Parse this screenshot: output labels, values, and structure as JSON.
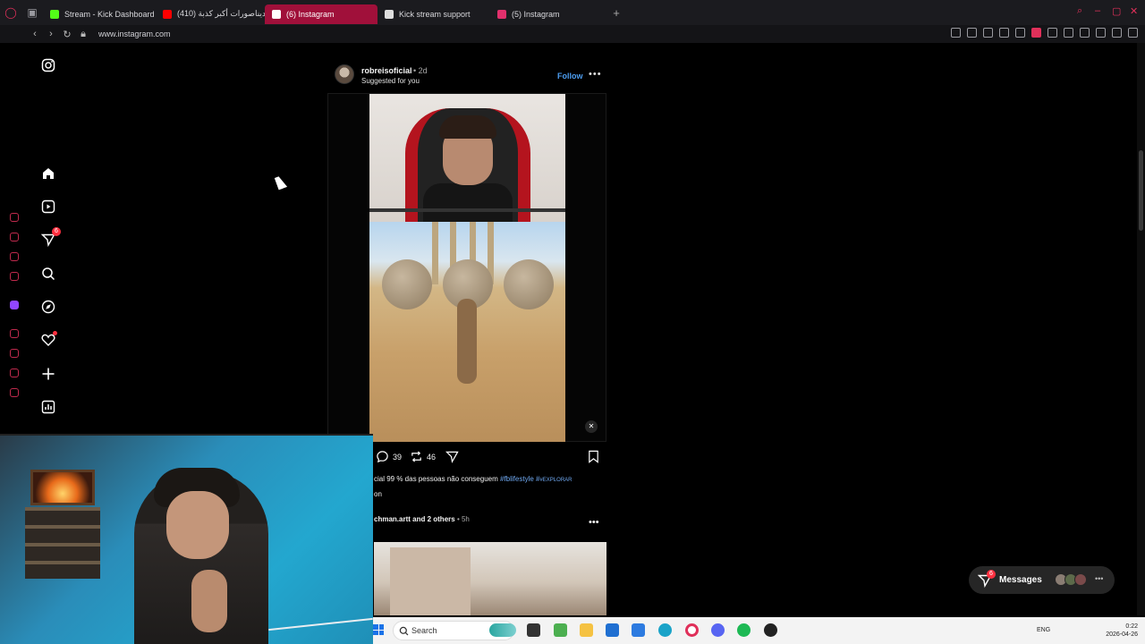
{
  "browser": {
    "tabs": [
      {
        "label": "Stream - Kick Dashboard",
        "color": "#53fc18",
        "active": false
      },
      {
        "label": "الديناصورات أكبر كذبة (410)",
        "color": "#ff0000",
        "active": false
      },
      {
        "label": "(6) Instagram",
        "color": "#e1306c",
        "active": true
      },
      {
        "label": "Kick stream support",
        "color": "#ffffff",
        "active": false
      },
      {
        "label": "(5) Instagram",
        "color": "#e1306c",
        "active": false
      }
    ],
    "url": "www.instagram.com",
    "accent": "#a0103a"
  },
  "instagram": {
    "nav": {
      "notifications_badge": "6",
      "items": [
        "instagram-logo",
        "home",
        "reels",
        "messages",
        "search",
        "explore",
        "notifications",
        "create",
        "dashboard"
      ]
    },
    "post": {
      "username": "robreisoficial",
      "time": "• 2d",
      "subtitle": "Suggested for you",
      "follow_label": "Follow",
      "more_label": "•••",
      "comments": "39",
      "reposts": "46",
      "caption_text": "cial 99 % das pessoas não conseguem",
      "caption_tags": "#fblifestyle #",
      "caption_tag2": "#EXPLORAR",
      "caption_line2": "on"
    },
    "post2": {
      "username": "chman.artt",
      "others": "and 2 others",
      "time": "• 5h",
      "more_label": "•••"
    },
    "messages": {
      "label": "Messages",
      "badge": "6"
    }
  },
  "taskbar": {
    "search_placeholder": "Search",
    "language": "ENG",
    "time": "0:22",
    "date": "2026-04-26"
  }
}
